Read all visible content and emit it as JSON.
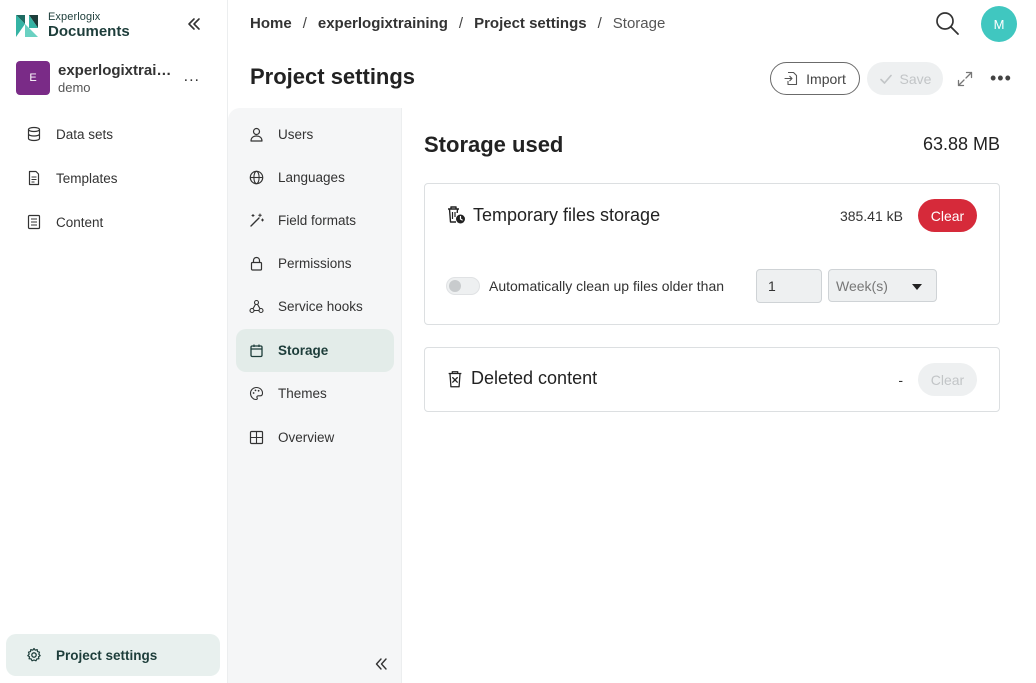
{
  "logo": {
    "small": "Experlogix",
    "big": "Documents"
  },
  "project": {
    "initial": "E",
    "name": "experlogixtraining",
    "sub": "demo",
    "more": "..."
  },
  "sidebar": {
    "items": [
      {
        "label": "Data sets",
        "icon": "database-icon"
      },
      {
        "label": "Templates",
        "icon": "document-icon"
      },
      {
        "label": "Content",
        "icon": "content-icon"
      }
    ],
    "bottom": {
      "label": "Project settings",
      "icon": "gear-icon"
    }
  },
  "breadcrumb": {
    "items": [
      "Home",
      "experlogixtraining",
      "Project settings"
    ],
    "current": "Storage",
    "sep": "/"
  },
  "user": {
    "initial": "M",
    "color": "#40c7c0"
  },
  "header": {
    "title": "Project settings",
    "import_label": "Import",
    "save_label": "Save",
    "more": "•••"
  },
  "subnav": {
    "items": [
      {
        "label": "Users",
        "icon": "user-icon"
      },
      {
        "label": "Languages",
        "icon": "globe-icon"
      },
      {
        "label": "Field formats",
        "icon": "magic-wand-icon"
      },
      {
        "label": "Permissions",
        "icon": "lock-icon"
      },
      {
        "label": "Service hooks",
        "icon": "webhook-icon"
      },
      {
        "label": "Storage",
        "icon": "storage-icon",
        "active": true
      },
      {
        "label": "Themes",
        "icon": "palette-icon"
      },
      {
        "label": "Overview",
        "icon": "table-icon"
      }
    ]
  },
  "storage": {
    "title": "Storage used",
    "total": "63.88 MB",
    "temporary": {
      "title": "Temporary files storage",
      "size": "385.41 kB",
      "clear_label": "Clear",
      "auto_label": "Automatically clean up files older than",
      "auto_enabled": false,
      "value": "1",
      "unit": "Week(s)"
    },
    "deleted": {
      "title": "Deleted content",
      "size": "-",
      "clear_label": "Clear"
    }
  },
  "colors": {
    "accent": "#1d3d3a",
    "danger": "#d62a3a",
    "project": "#7a2b87",
    "active_bg": "#e3ece9"
  }
}
